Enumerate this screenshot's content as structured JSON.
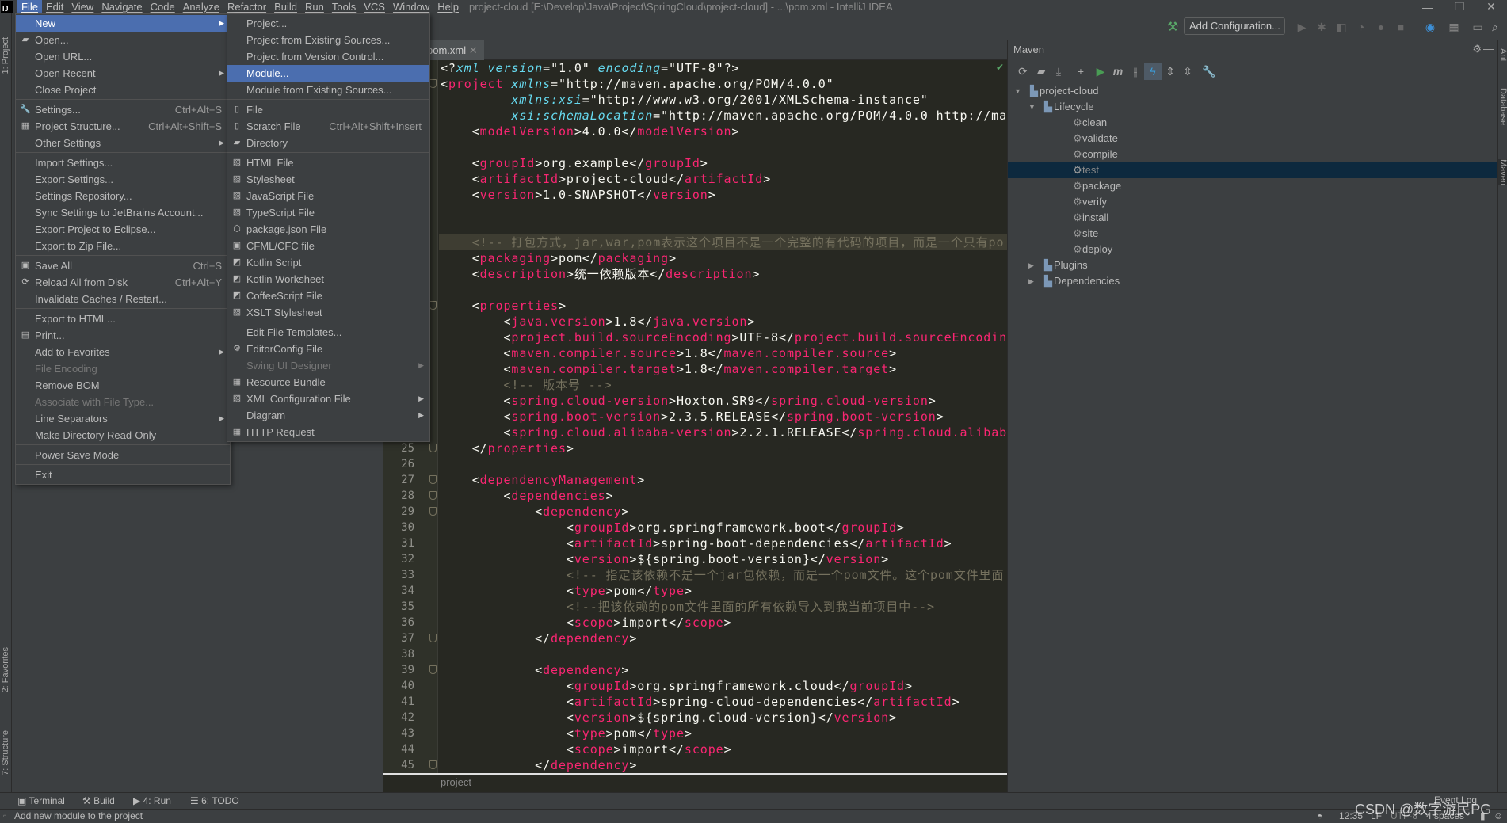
{
  "app": {
    "title": "project-cloud [E:\\Develop\\Java\\Project\\SpringCloud\\project-cloud] - ...\\pom.xml - IntelliJ IDEA",
    "logo": "IJ"
  },
  "menubar": [
    "File",
    "Edit",
    "View",
    "Navigate",
    "Code",
    "Analyze",
    "Refactor",
    "Build",
    "Run",
    "Tools",
    "VCS",
    "Window",
    "Help"
  ],
  "toolbar": {
    "add_configuration": "Add Configuration..."
  },
  "colors": {
    "accent": "#4b6eaf",
    "tag": "#f92672",
    "attribute": "#66d9ef",
    "comment": "#75715e",
    "editor_bg": "#272822",
    "selection": "#0d293e"
  },
  "left_strip": [
    "1: Project",
    "2: Favorites",
    "7: Structure"
  ],
  "right_strip": [
    "Ant",
    "Database",
    "Maven"
  ],
  "editor": {
    "tab": "pom.xml",
    "current_line": 12,
    "breadcrumb": "project",
    "lines": [
      "<?xml version=\"1.0\" encoding=\"UTF-8\"?>",
      "<project xmlns=\"http://maven.apache.org/POM/4.0.0\"",
      "         xmlns:xsi=\"http://www.w3.org/2001/XMLSchema-instance\"",
      "         xsi:schemaLocation=\"http://maven.apache.org/POM/4.0.0 http://ma",
      "    <modelVersion>4.0.0</modelVersion>",
      "",
      "    <groupId>org.example</groupId>",
      "    <artifactId>project-cloud</artifactId>",
      "    <version>1.0-SNAPSHOT</version>",
      "",
      "",
      "    <!-- 打包方式，jar,war,pom表示这个项目不是一个完整的有代码的项目，而是一个只有po",
      "    <packaging>pom</packaging>",
      "    <description>统一依赖版本</description>",
      "",
      "    <properties>",
      "        <java.version>1.8</java.version>",
      "        <project.build.sourceEncoding>UTF-8</project.build.sourceEncodin",
      "        <maven.compiler.source>1.8</maven.compiler.source>",
      "        <maven.compiler.target>1.8</maven.compiler.target>",
      "        <!-- 版本号 -->",
      "        <spring.cloud-version>Hoxton.SR9</spring.cloud-version>",
      "        <spring.boot-version>2.3.5.RELEASE</spring.boot-version>",
      "        <spring.cloud.alibaba-version>2.2.1.RELEASE</spring.cloud.alibab",
      "    </properties>",
      "",
      "    <dependencyManagement>",
      "        <dependencies>",
      "            <dependency>",
      "                <groupId>org.springframework.boot</groupId>",
      "                <artifactId>spring-boot-dependencies</artifactId>",
      "                <version>${spring.boot-version}</version>",
      "                <!-- 指定该依赖不是一个jar包依赖，而是一个pom文件。这个pom文件里面",
      "                <type>pom</type>",
      "                <!--把该依赖的pom文件里面的所有依赖导入到我当前项目中-->",
      "                <scope>import</scope>",
      "            </dependency>",
      "",
      "            <dependency>",
      "                <groupId>org.springframework.cloud</groupId>",
      "                <artifactId>spring-cloud-dependencies</artifactId>",
      "                <version>${spring.cloud-version}</version>",
      "                <type>pom</type>",
      "                <scope>import</scope>",
      "            </dependency>"
    ],
    "fold_lines": [
      2,
      16,
      25,
      27,
      28,
      29,
      37,
      39,
      45
    ]
  },
  "maven": {
    "title": "Maven",
    "toolbar": [
      "refresh-icon",
      "add-folder-icon",
      "download-icon",
      "plus-icon",
      "run-icon",
      "maven-m-icon",
      "toggle-offline-icon",
      "lightning-icon",
      "expand-all-icon",
      "collapse-all-icon",
      "wrench-icon"
    ],
    "tree": [
      {
        "label": "project-cloud",
        "level": 0,
        "arrow": "▼",
        "icon": "module-icon"
      },
      {
        "label": "Lifecycle",
        "level": 1,
        "arrow": "▼",
        "icon": "folder-icon"
      },
      {
        "label": "clean",
        "level": 2,
        "icon": "gear-icon"
      },
      {
        "label": "validate",
        "level": 2,
        "icon": "gear-icon"
      },
      {
        "label": "compile",
        "level": 2,
        "icon": "gear-icon"
      },
      {
        "label": "test",
        "level": 2,
        "icon": "gear-icon",
        "selected": true
      },
      {
        "label": "package",
        "level": 2,
        "icon": "gear-icon"
      },
      {
        "label": "verify",
        "level": 2,
        "icon": "gear-icon"
      },
      {
        "label": "install",
        "level": 2,
        "icon": "gear-icon"
      },
      {
        "label": "site",
        "level": 2,
        "icon": "gear-icon"
      },
      {
        "label": "deploy",
        "level": 2,
        "icon": "gear-icon"
      },
      {
        "label": "Plugins",
        "level": 1,
        "arrow": "▶",
        "icon": "folder-icon"
      },
      {
        "label": "Dependencies",
        "level": 1,
        "arrow": "▶",
        "icon": "folder-icon"
      }
    ]
  },
  "file_menu": [
    {
      "label": "New",
      "arrow": true,
      "selected": true
    },
    {
      "label": "Open...",
      "icon": "▰"
    },
    {
      "label": "Open URL..."
    },
    {
      "label": "Open Recent",
      "arrow": true
    },
    {
      "label": "Close Project"
    },
    {
      "sep": true
    },
    {
      "label": "Settings...",
      "shortcut": "Ctrl+Alt+S",
      "icon": "🔧"
    },
    {
      "label": "Project Structure...",
      "shortcut": "Ctrl+Alt+Shift+S",
      "icon": "▦"
    },
    {
      "label": "Other Settings",
      "arrow": true
    },
    {
      "sep": true
    },
    {
      "label": "Import Settings..."
    },
    {
      "label": "Export Settings..."
    },
    {
      "label": "Settings Repository..."
    },
    {
      "label": "Sync Settings to JetBrains Account..."
    },
    {
      "label": "Export Project to Eclipse..."
    },
    {
      "label": "Export to Zip File..."
    },
    {
      "sep": true
    },
    {
      "label": "Save All",
      "shortcut": "Ctrl+S",
      "icon": "▣"
    },
    {
      "label": "Reload All from Disk",
      "shortcut": "Ctrl+Alt+Y",
      "icon": "⟳"
    },
    {
      "label": "Invalidate Caches / Restart..."
    },
    {
      "sep": true
    },
    {
      "label": "Export to HTML..."
    },
    {
      "label": "Print...",
      "icon": "▤"
    },
    {
      "label": "Add to Favorites",
      "arrow": true
    },
    {
      "label": "File Encoding",
      "disabled": true
    },
    {
      "label": "Remove BOM"
    },
    {
      "label": "Associate with File Type...",
      "disabled": true
    },
    {
      "label": "Line Separators",
      "arrow": true
    },
    {
      "label": "Make Directory Read-Only"
    },
    {
      "sep": true
    },
    {
      "label": "Power Save Mode"
    },
    {
      "sep": true
    },
    {
      "label": "Exit"
    }
  ],
  "new_menu": [
    {
      "label": "Project..."
    },
    {
      "label": "Project from Existing Sources..."
    },
    {
      "label": "Project from Version Control..."
    },
    {
      "label": "Module...",
      "selected": true
    },
    {
      "label": "Module from Existing Sources..."
    },
    {
      "sep": true
    },
    {
      "label": "File",
      "icon": "▯"
    },
    {
      "label": "Scratch File",
      "shortcut": "Ctrl+Alt+Shift+Insert",
      "icon": "▯"
    },
    {
      "label": "Directory",
      "icon": "▰"
    },
    {
      "sep": true
    },
    {
      "label": "HTML File",
      "icon": "▧"
    },
    {
      "label": "Stylesheet",
      "icon": "▧"
    },
    {
      "label": "JavaScript File",
      "icon": "▧"
    },
    {
      "label": "TypeScript File",
      "icon": "▧"
    },
    {
      "label": "package.json File",
      "icon": "⬡"
    },
    {
      "label": "CFML/CFC file",
      "icon": "▣"
    },
    {
      "label": "Kotlin Script",
      "icon": "◩"
    },
    {
      "label": "Kotlin Worksheet",
      "icon": "◩"
    },
    {
      "label": "CoffeeScript File",
      "icon": "◩"
    },
    {
      "label": "XSLT Stylesheet",
      "icon": "▧"
    },
    {
      "sep": true
    },
    {
      "label": "Edit File Templates..."
    },
    {
      "label": "EditorConfig File",
      "icon": "⚙"
    },
    {
      "label": "Swing UI Designer",
      "arrow": true,
      "disabled": true
    },
    {
      "label": "Resource Bundle",
      "icon": "▦"
    },
    {
      "label": "XML Configuration File",
      "arrow": true,
      "icon": "▧"
    },
    {
      "label": "Diagram",
      "arrow": true
    },
    {
      "label": "HTTP Request",
      "icon": "▦"
    }
  ],
  "tool_windows": [
    {
      "label": "Terminal",
      "icon": "terminal-icon"
    },
    {
      "label": "Build",
      "icon": "hammer-icon"
    },
    {
      "label": "4: Run",
      "icon": "run-icon"
    },
    {
      "label": "6: TODO",
      "icon": "todo-icon"
    }
  ],
  "status": {
    "message": "Add new module to the project",
    "position": "12:35",
    "line_sep": "LF",
    "encoding": "UTF-8",
    "indent": "4 spaces",
    "event_log": "Event Log",
    "watermark": "CSDN @数字游民PG"
  }
}
